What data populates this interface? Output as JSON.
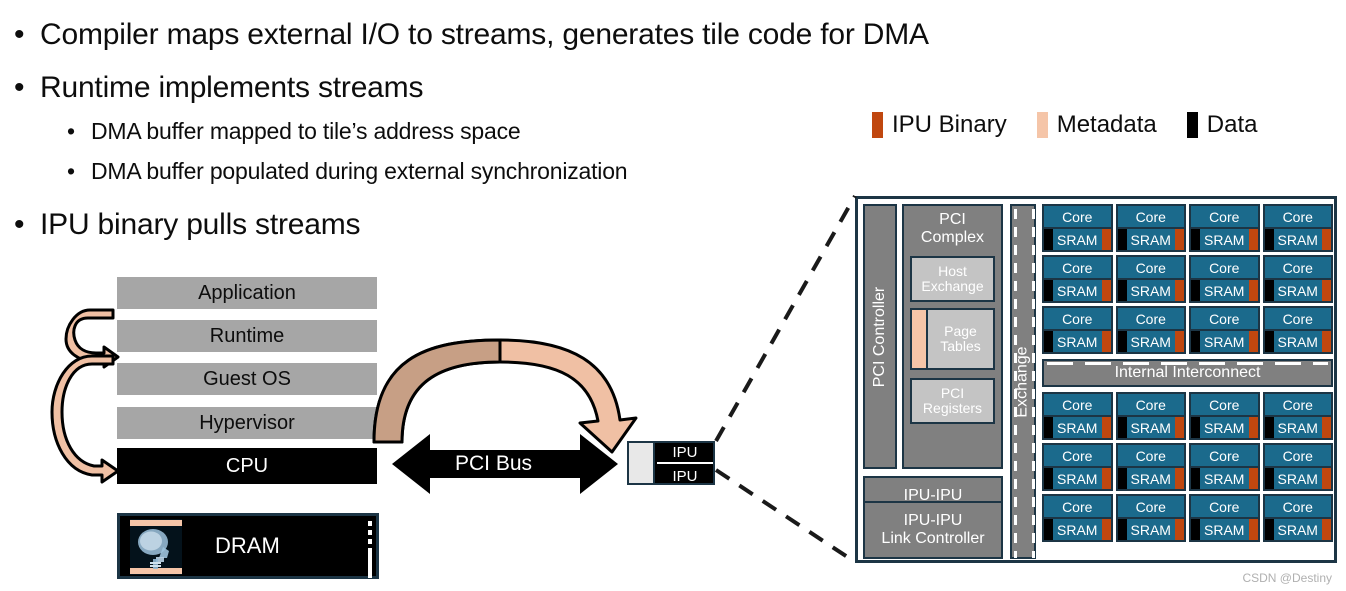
{
  "slide": {
    "bullets_level1": [
      "Compiler maps external I/O to streams, generates tile code for DMA",
      "Runtime implements streams",
      "IPU binary pulls streams"
    ],
    "bullets_level2": [
      "DMA buffer mapped to tile’s address space",
      "DMA buffer populated during external synchronization"
    ],
    "bullet_glyph": "•",
    "watermark": "CSDN @Destiny"
  },
  "legend": {
    "items": [
      {
        "label": "IPU Binary",
        "color": "#c0470f",
        "icon": "legend-swatch"
      },
      {
        "label": "Metadata",
        "color": "#f5c5a8",
        "icon": "legend-swatch"
      },
      {
        "label": "Data",
        "color": "#000000",
        "icon": "legend-swatch"
      }
    ]
  },
  "software_stack": {
    "layers": [
      {
        "label": "Application",
        "style": "gray"
      },
      {
        "label": "Runtime",
        "style": "gray"
      },
      {
        "label": "Guest OS",
        "style": "gray"
      },
      {
        "label": "Hypervisor",
        "style": "gray"
      },
      {
        "label": "CPU",
        "style": "black"
      }
    ],
    "memory": {
      "label": "DRAM"
    }
  },
  "bus": {
    "label": "PCI Bus"
  },
  "ipu_card": {
    "rows": [
      "IPU",
      "IPU"
    ]
  },
  "ipu_diagram": {
    "pci_controller": "PCI Controller",
    "pci_complex": {
      "title": "PCI\nComplex",
      "title_line1": "PCI",
      "title_line2": "Complex",
      "host_exchange_l1": "Host",
      "host_exchange_l2": "Exchange",
      "page_tables_l1": "Page",
      "page_tables_l2": "Tables",
      "pci_registers_l1": "PCI",
      "pci_registers_l2": "Registers"
    },
    "link_controllers": [
      {
        "line1": "IPU-IPU",
        "line2": "Link Controller"
      },
      {
        "line1": "IPU-IPU",
        "line2": "Link Controller"
      }
    ],
    "exchange": "Exchange",
    "interconnect": "Internal Interconnect",
    "tile": {
      "core_label": "Core",
      "sram_label": "SRAM"
    },
    "tile_grid_top": {
      "rows": 3,
      "cols": 4
    },
    "tile_grid_bottom": {
      "rows": 3,
      "cols": 4
    }
  },
  "colors": {
    "ipu_binary": "#c0470f",
    "metadata": "#f5c5a8",
    "data": "#000000",
    "tile_blue": "#1b6a8c",
    "frame_navy": "#1c3545",
    "gray_block": "#808080",
    "stack_gray": "#a6a6a6"
  }
}
